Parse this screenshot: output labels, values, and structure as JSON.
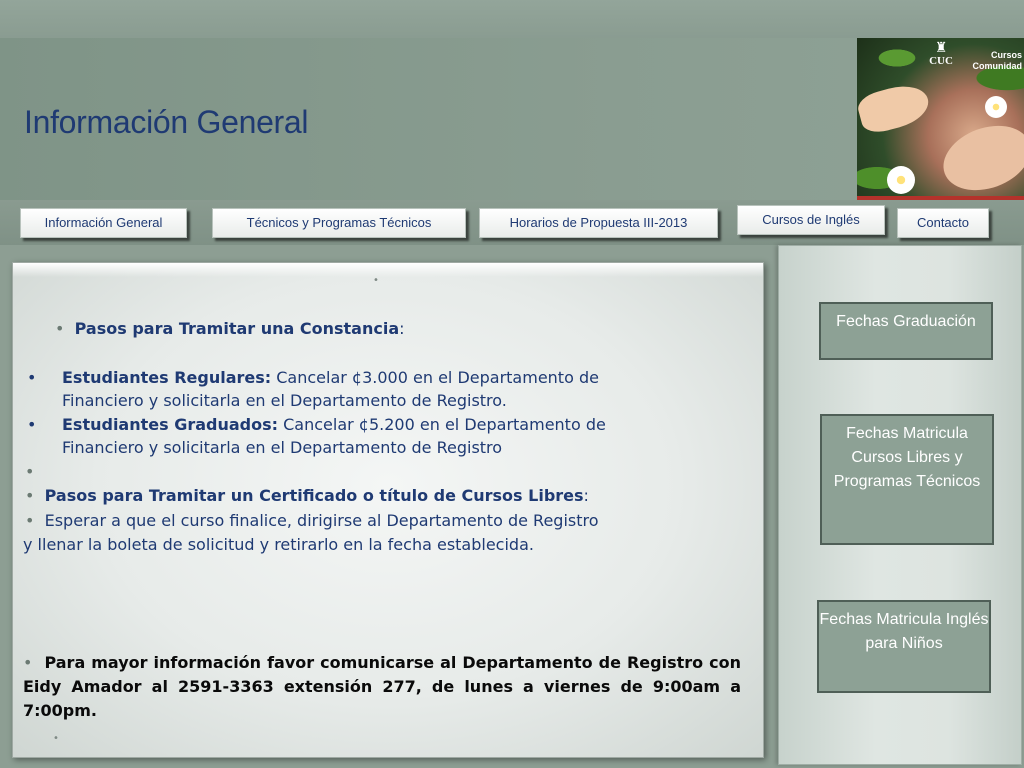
{
  "header": {
    "title": "Información General",
    "brand_line1": "Cursos",
    "brand_line2": "Comunidad",
    "logo_text": "CUC",
    "logo_icon": "cuc-crest-icon"
  },
  "nav": {
    "items": [
      {
        "label": "Información General"
      },
      {
        "label": "Técnicos y Programas Técnicos"
      },
      {
        "label": "Horarios de Propuesta III-2013"
      },
      {
        "label": "Cursos de Inglés"
      },
      {
        "label": "Contacto"
      }
    ]
  },
  "content": {
    "bullet": "•",
    "constancia_heading": "Pasos para Tramitar una Constancia",
    "colon": ":",
    "regulares_label": "Estudiantes Regulares:",
    "regulares_text_1": " Cancelar ¢3.000 en el Departamento de",
    "regulares_text_2": "Financiero y solicitarla en el Departamento de Registro.",
    "graduados_label": "Estudiantes Graduados:",
    "graduados_text_1": " Cancelar ¢5.200 en el Departamento de",
    "graduados_text_2": "Financiero y solicitarla en el Departamento de Registro",
    "certificado_heading": "Pasos para Tramitar un Certificado o título de Cursos Libres",
    "certificado_text_1": "Esperar a que el curso finalice, dirigirse al Departamento de Registro",
    "certificado_text_2": "y llenar la boleta de solicitud y retirarlo en la fecha establecida.",
    "contact_text": "Para mayor información favor comunicarse al Departamento de Registro con Eidy Amador al 2591-3363 extensión 277, de lunes a viernes de 9:00am a 7:00pm",
    "period": "."
  },
  "sidebar": {
    "items": [
      {
        "label": "Fechas Graduación"
      },
      {
        "label": "Fechas Matricula Cursos Libres y Programas Técnicos"
      },
      {
        "label": "Fechas Matricula Inglés para Niños"
      }
    ]
  }
}
